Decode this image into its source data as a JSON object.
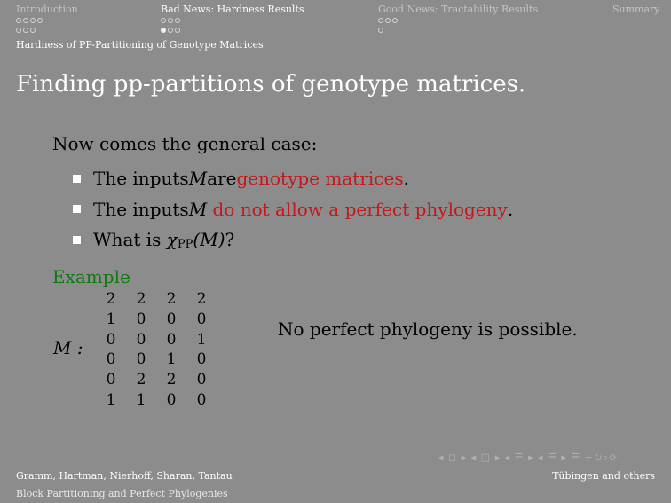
{
  "nav": {
    "sections": [
      {
        "label": "Introduction",
        "active": false,
        "dots": [
          [
            0,
            0,
            0,
            0
          ],
          [
            0,
            0,
            0
          ]
        ]
      },
      {
        "label": "Bad News: Hardness Results",
        "active": true,
        "dots": [
          [
            0,
            0,
            0
          ],
          [
            1,
            0,
            0
          ]
        ]
      },
      {
        "label": "Good News: Tractability Results",
        "active": false,
        "dots": [
          [
            0,
            0,
            0
          ],
          [
            0
          ]
        ]
      },
      {
        "label": "Summary",
        "active": false,
        "dots": []
      }
    ],
    "subsection": "Hardness of PP-Partitioning of Genotype Matrices"
  },
  "frame": {
    "title": "Finding pp-partitions of genotype matrices.",
    "intro": "Now comes the general case:",
    "bullet1_pre": "The inputs ",
    "bullet1_var": "M",
    "bullet1_mid": " are ",
    "bullet1_red": "genotype matrices",
    "bullet1_post": ".",
    "bullet2_pre": "The inputs ",
    "bullet2_var": "M",
    "bullet2_red": "do not allow a perfect phylogeny",
    "bullet2_post": ".",
    "bullet3_pre": "What is ",
    "bullet3_chi": "χ",
    "bullet3_sub": "PP",
    "bullet3_arg": "(M)",
    "bullet3_post": "?",
    "example_label": "Example",
    "matrix_label": "M :",
    "matrix": [
      [
        "2",
        "2",
        "2",
        "2"
      ],
      [
        "1",
        "0",
        "0",
        "0"
      ],
      [
        "0",
        "0",
        "0",
        "1"
      ],
      [
        "0",
        "0",
        "1",
        "0"
      ],
      [
        "0",
        "2",
        "2",
        "0"
      ],
      [
        "1",
        "1",
        "0",
        "0"
      ]
    ],
    "note": "No perfect phylogeny is possible."
  },
  "beamer_nav": "◂ ◻ ▸ ◂ ◫ ▸ ◂ ☰ ▸ ◂ ☰ ▸ ☰ ∽↻⌕⟳",
  "footer": {
    "authors": "Gramm, Hartman, Nierhoff, Sharan, Tantau",
    "institute": "Tübingen and others",
    "short_title": "Block Partitioning and Perfect Phylogenies"
  }
}
